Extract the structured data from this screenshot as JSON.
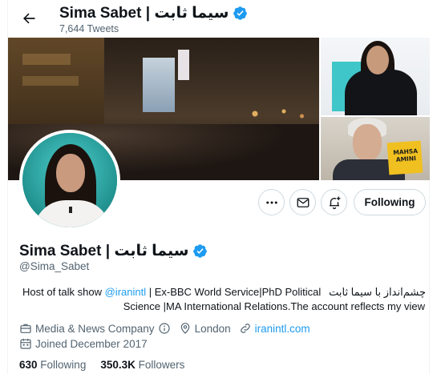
{
  "header": {
    "back_icon": "arrow-left-icon",
    "name": "Sima Sabet | سیما ثابت",
    "tweet_count": "7,644 Tweets"
  },
  "banner": {
    "poster_text": "MAHSA AMINI"
  },
  "actions": {
    "more_icon": "more-icon",
    "message_icon": "envelope-icon",
    "notify_icon": "bell-plus-icon",
    "follow_label": "Following"
  },
  "profile": {
    "name": "Sima Sabet | سیما ثابت",
    "handle": "@Sima_Sabet",
    "bio_line1_prefix": "Host of talk show ",
    "bio_mention": "@iranintl",
    "bio_line1_suffix": " | Ex-BBC World Service|PhD Political",
    "bio_farsi": "چشم‌انداز با سیما ثابت",
    "bio_line2": "Science |MA International Relations.The account reflects my view",
    "category": "Media & News Company",
    "location": "London",
    "website": "iranintl.com",
    "joined": "Joined December 2017",
    "following_count": "630",
    "following_label": "Following",
    "followers_count": "350.3K",
    "followers_label": "Followers"
  },
  "colors": {
    "accent": "#1d9bf0",
    "text": "#0f1419",
    "muted": "#536471",
    "border": "#cfd9de"
  }
}
